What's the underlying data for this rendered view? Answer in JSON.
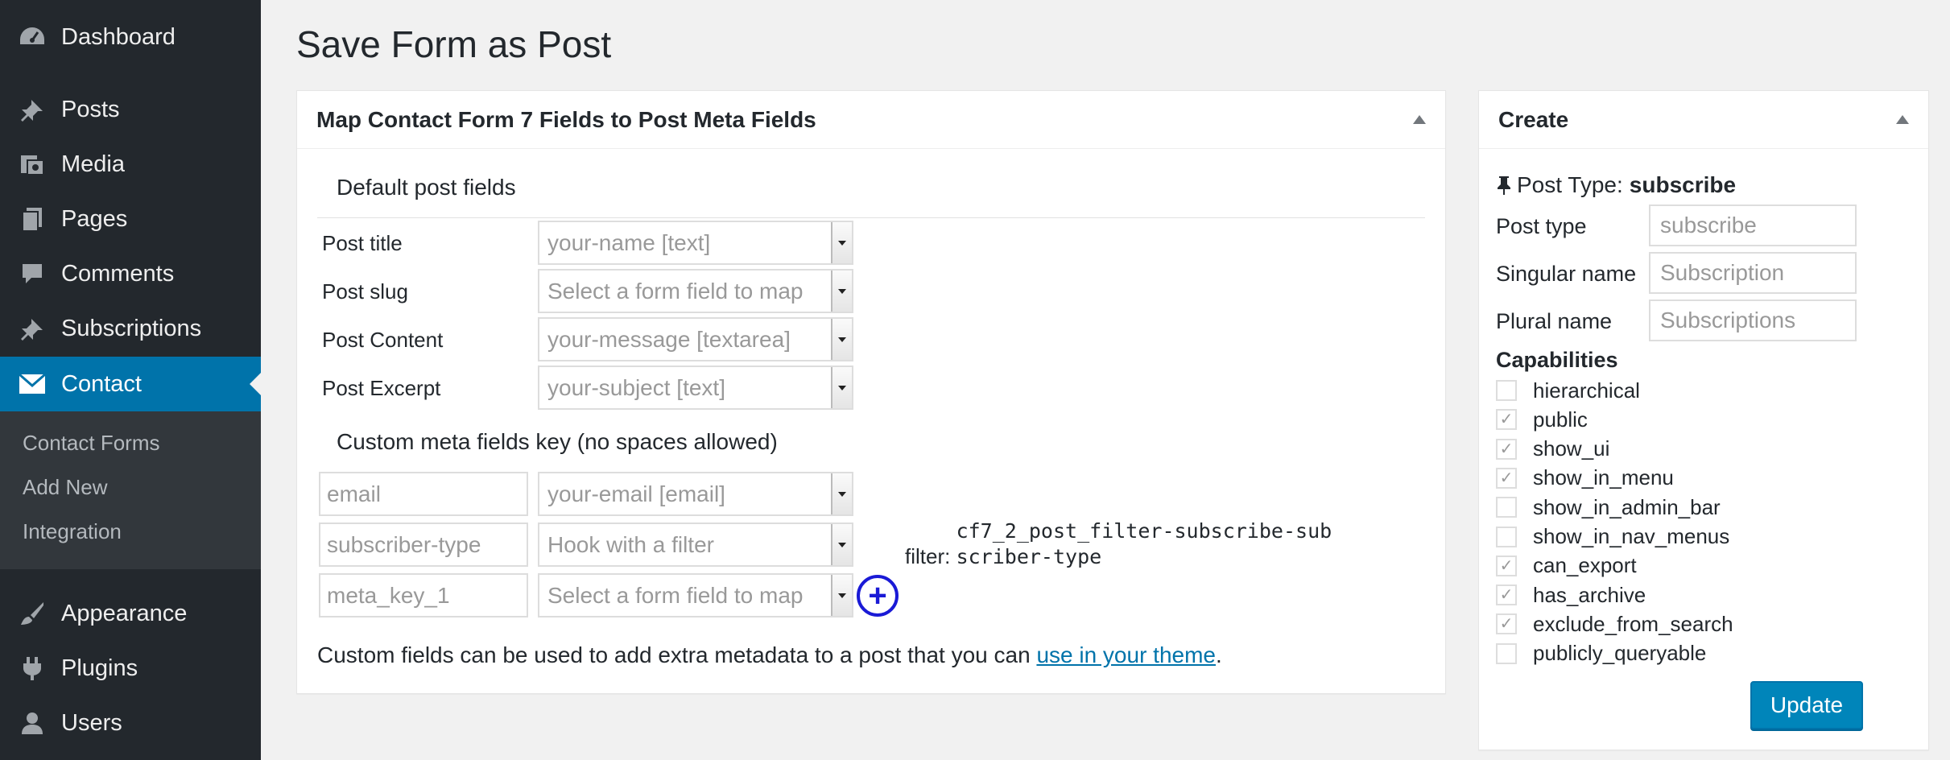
{
  "sidebar": {
    "items": [
      {
        "label": "Dashboard",
        "icon": "dashboard-icon"
      },
      {
        "label": "Posts",
        "icon": "pushpin-icon"
      },
      {
        "label": "Media",
        "icon": "media-icon"
      },
      {
        "label": "Pages",
        "icon": "pages-icon"
      },
      {
        "label": "Comments",
        "icon": "comments-icon"
      },
      {
        "label": "Subscriptions",
        "icon": "pushpin-icon"
      },
      {
        "label": "Contact",
        "icon": "envelope-icon"
      },
      {
        "label": "Appearance",
        "icon": "paintbrush-icon"
      },
      {
        "label": "Plugins",
        "icon": "plugin-icon"
      },
      {
        "label": "Users",
        "icon": "user-icon"
      }
    ],
    "submenu": [
      "Contact Forms",
      "Add New",
      "Integration"
    ],
    "active_color": "#0073aa",
    "background": "#23282d"
  },
  "page": {
    "title": "Save Form as Post"
  },
  "map_box": {
    "title": "Map Contact Form 7 Fields to Post Meta Fields",
    "default_section": "Default post fields",
    "default_fields": [
      {
        "label": "Post title",
        "value": "your-name [text]"
      },
      {
        "label": "Post slug",
        "value": "Select a form field to map"
      },
      {
        "label": "Post Content",
        "value": "your-message [textarea]"
      },
      {
        "label": "Post Excerpt",
        "value": "your-subject [text]"
      }
    ],
    "custom_section": "Custom meta fields key (no spaces allowed)",
    "custom_fields": [
      {
        "key_placeholder": "email",
        "value": "your-email [email]"
      },
      {
        "key_placeholder": "subscriber-type",
        "value": "Hook with a filter"
      },
      {
        "key_placeholder": "meta_key_1",
        "value": "Select a form field to map"
      }
    ],
    "filter_prefix": "filter: ",
    "filter_code": "cf7_2_post_filter-subscribe-subscriber-type",
    "help_text": "Custom fields can be used to add extra metadata to a post that you can ",
    "help_link": "use in your theme",
    "help_end": "."
  },
  "create_box": {
    "title": "Create",
    "post_type_label": "Post Type:",
    "post_type_value": "subscribe",
    "fields": [
      {
        "label": "Post type",
        "placeholder": "subscribe"
      },
      {
        "label": "Singular name",
        "placeholder": "Subscription"
      },
      {
        "label": "Plural name",
        "placeholder": "Subscriptions"
      }
    ],
    "capabilities_title": "Capabilities",
    "capabilities": [
      {
        "name": "hierarchical",
        "checked": false
      },
      {
        "name": "public",
        "checked": true
      },
      {
        "name": "show_ui",
        "checked": true
      },
      {
        "name": "show_in_menu",
        "checked": true
      },
      {
        "name": "show_in_admin_bar",
        "checked": false
      },
      {
        "name": "show_in_nav_menus",
        "checked": false
      },
      {
        "name": "can_export",
        "checked": true
      },
      {
        "name": "has_archive",
        "checked": true
      },
      {
        "name": "exclude_from_search",
        "checked": true
      },
      {
        "name": "publicly_queryable",
        "checked": false
      }
    ],
    "update_label": "Update"
  }
}
